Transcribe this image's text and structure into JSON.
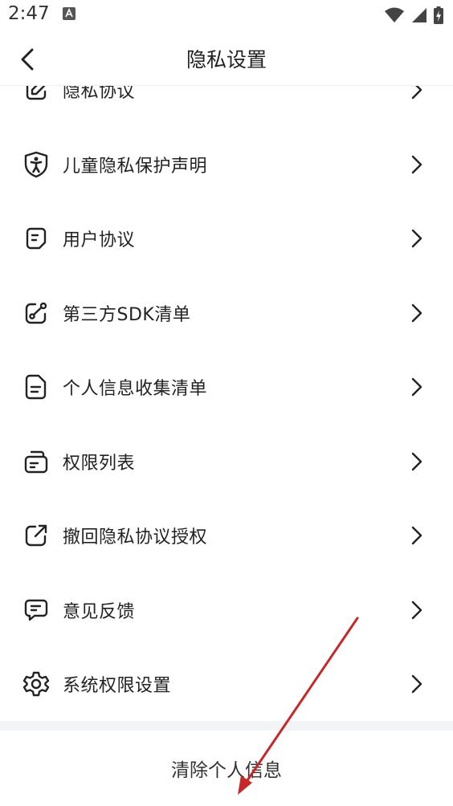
{
  "status_bar": {
    "time": "2:47"
  },
  "header": {
    "title": "隐私设置"
  },
  "items": [
    {
      "label": "隐私协议",
      "icon": "pen-doc-icon"
    },
    {
      "label": "儿童隐私保护声明",
      "icon": "child-shield-icon"
    },
    {
      "label": "用户协议",
      "icon": "user-doc-icon"
    },
    {
      "label": "第三方SDK清单",
      "icon": "share-link-icon"
    },
    {
      "label": "个人信息收集清单",
      "icon": "document-icon"
    },
    {
      "label": "权限列表",
      "icon": "list-badge-icon"
    },
    {
      "label": "撤回隐私协议授权",
      "icon": "external-link-icon"
    },
    {
      "label": "意见反馈",
      "icon": "chat-bubble-icon"
    },
    {
      "label": "系统权限设置",
      "icon": "gear-icon"
    }
  ],
  "footer": {
    "clear_label": "清除个人信息"
  },
  "colors": {
    "annotation_arrow": "#c62828",
    "text": "#222222",
    "band": "#f3f4f6"
  }
}
